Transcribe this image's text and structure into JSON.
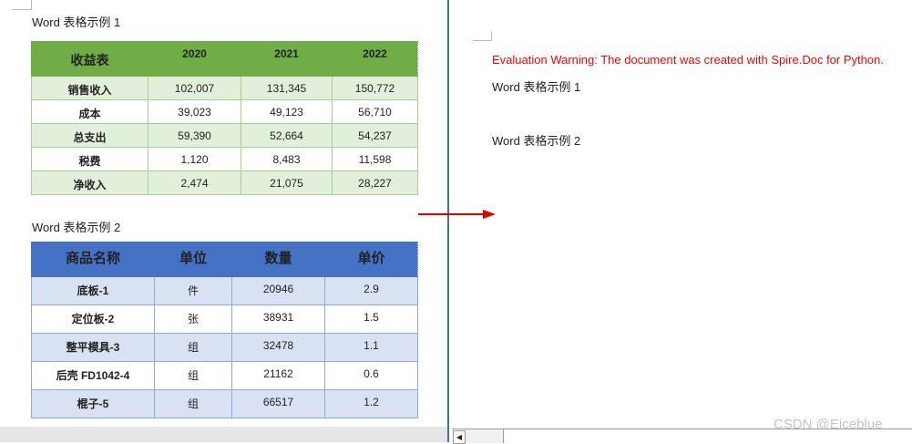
{
  "left_doc": {
    "caption1": "Word 表格示例 1",
    "table1": {
      "headers": [
        "收益表",
        "2020",
        "2021",
        "2022"
      ],
      "rows": [
        [
          "销售收入",
          "102,007",
          "131,345",
          "150,772"
        ],
        [
          "成本",
          "39,023",
          "49,123",
          "56,710"
        ],
        [
          "总支出",
          "59,390",
          "52,664",
          "54,237"
        ],
        [
          "税费",
          "1,120",
          "8,483",
          "11,598"
        ],
        [
          "净收入",
          "2,474",
          "21,075",
          "28,227"
        ]
      ]
    },
    "caption2": "Word 表格示例 2",
    "table2": {
      "headers": [
        "商品名称",
        "单位",
        "数量",
        "单价"
      ],
      "rows": [
        [
          "底板-1",
          "件",
          "20946",
          "2.9"
        ],
        [
          "定位板-2",
          "张",
          "38931",
          "1.5"
        ],
        [
          "整平模具-3",
          "组",
          "32478",
          "1.1"
        ],
        [
          "后壳 FD1042-4",
          "组",
          "21162",
          "0.6"
        ],
        [
          "棍子-5",
          "组",
          "66517",
          "1.2"
        ]
      ]
    }
  },
  "right_doc": {
    "warning": "Evaluation Warning: The document was created with Spire.Doc for Python.",
    "line1": "Word 表格示例 1",
    "line2": "Word 表格示例 2"
  },
  "watermark": "CSDN @Eiceblue",
  "colors": {
    "green_header": "#70ad47",
    "green_band": "#e2efda",
    "blue_header": "#4472c4",
    "blue_band": "#d9e2f3",
    "warning": "#ff0000",
    "arrow": "#e00000"
  }
}
